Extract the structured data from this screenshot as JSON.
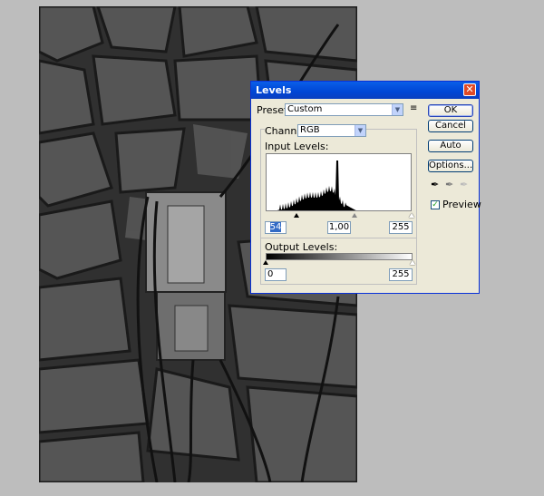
{
  "dialog": {
    "title": "Levels",
    "preset_label": "Preset:",
    "preset_value": "Custom",
    "channel_label": "Channel:",
    "channel_value": "RGB",
    "input_levels_label": "Input Levels:",
    "input_black": "54",
    "input_gamma": "1,00",
    "input_white": "255",
    "output_levels_label": "Output Levels:",
    "output_black": "0",
    "output_white": "255",
    "buttons": {
      "ok": "OK",
      "cancel": "Cancel",
      "auto": "Auto",
      "options": "Options..."
    },
    "preview_label": "Preview",
    "preview_checked": true,
    "input_black_level": 54,
    "input_white_level": 255,
    "input_gamma_level": 1.0
  },
  "colors": {
    "titlebar": "#0a5ee8",
    "close_button": "#e04a26",
    "dialog_bg": "#ece9d8",
    "workspace_bg": "#bdbdbd"
  },
  "icons": {
    "close": "close-icon",
    "preset_menu": "preset-menu-icon",
    "black_eyedropper": "black-eyedropper-icon",
    "gray_eyedropper": "gray-eyedropper-icon",
    "white_eyedropper": "white-eyedropper-icon"
  }
}
